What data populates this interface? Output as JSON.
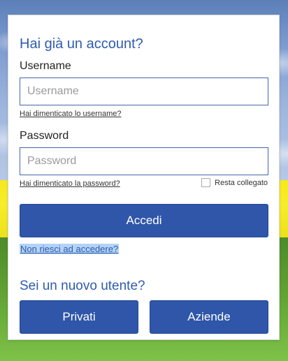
{
  "login": {
    "title": "Hai già un account?",
    "username_label": "Username",
    "username_placeholder": "Username",
    "username_value": "",
    "forgot_username": "Hai dimenticato lo username?",
    "password_label": "Password",
    "password_placeholder": "Password",
    "password_value": "",
    "forgot_password": "Hai dimenticato la password?",
    "remember_label": "Resta collegato",
    "remember_checked": false,
    "submit_label": "Accedi",
    "help_link": "Non riesci ad accedere?"
  },
  "signup": {
    "title": "Sei un nuovo utente?",
    "private_label": "Privati",
    "business_label": "Aziende"
  },
  "colors": {
    "accent": "#2f56a8",
    "heading": "#2f5bb0",
    "link_highlight": "#b3d3f5"
  }
}
